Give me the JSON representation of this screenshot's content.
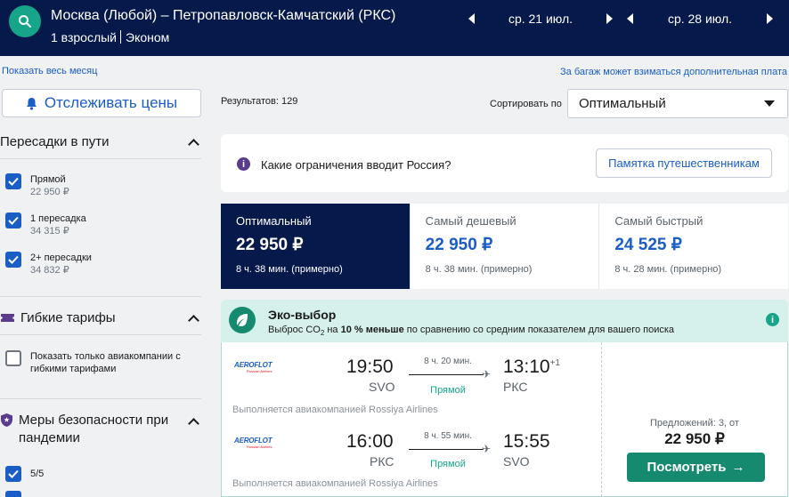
{
  "header": {
    "route": "Москва (Любой) – Петропавловск-Камчатский (РКС)",
    "passengers": "1 взрослый",
    "cabin": "Эконом",
    "date_out": "ср. 21 июл.",
    "date_back": "ср. 28 июл.",
    "colors": {
      "background": "#06194b",
      "search_button": "#17a589"
    },
    "icons": [
      "search-icon",
      "prev-date-icon",
      "next-date-icon"
    ]
  },
  "links": {
    "show_month": "Показать весь месяц",
    "baggage_note": "За багаж может взиматься дополнительная плата"
  },
  "sidebar": {
    "track_prices": "Отслеживать цены",
    "stops_section": {
      "title": "Пересадки в пути",
      "options": [
        {
          "label": "Прямой",
          "price": "22 950 ₽",
          "checked": true
        },
        {
          "label": "1 пересадка",
          "price": "34 315 ₽",
          "checked": true
        },
        {
          "label": "2+ пересадки",
          "price": "34 832 ₽",
          "checked": true
        }
      ]
    },
    "flex_section": {
      "title": "Гибкие тарифы",
      "option": "Показать только авиакомпании с гибкими тарифами",
      "checked": false
    },
    "safety_section": {
      "title": "Меры безопасности при пандемии",
      "option": "5/5",
      "checked": true
    }
  },
  "main": {
    "results": "Результатов: 129",
    "sort_label": "Сортировать по",
    "sort_value": "Оптимальный",
    "info": {
      "question": "Какие ограничения вводит Россия?",
      "memo_button": "Памятка путешественникам"
    },
    "sort_tabs": [
      {
        "name": "Оптимальный",
        "price": "22 950 ₽",
        "duration": "8 ч. 38 мин. (примерно)",
        "active": true
      },
      {
        "name": "Самый дешевый",
        "price": "22 950 ₽",
        "duration": "8 ч. 38 мин. (примерно)",
        "active": false
      },
      {
        "name": "Самый быстрый",
        "price": "24 525 ₽",
        "duration": "8 ч. 28 мин. (примерно)",
        "active": false
      }
    ],
    "eco": {
      "title": "Эко-выбор",
      "desc_pre": "Выброс CO",
      "desc_sub": "2",
      "desc_mid": " на ",
      "desc_bold": "10 % меньше",
      "desc_post": " по сравнению со средним показателем для вашего поиска"
    },
    "result": {
      "airline": "AEROFLOT",
      "airline_sub": "Russian Airlines",
      "legs": [
        {
          "dep_time": "19:50",
          "dep_code": "SVO",
          "arr_time": "13:10",
          "plus_day": "+1",
          "arr_code": "РКС",
          "duration": "8 ч. 20 мин.",
          "stops": "Прямой",
          "operated": "Выполняется авиакомпанией Rossiya Airlines"
        },
        {
          "dep_time": "16:00",
          "dep_code": "РКС",
          "arr_time": "15:55",
          "plus_day": "",
          "arr_code": "SVO",
          "duration": "8 ч. 55 мин.",
          "stops": "Прямой",
          "operated": "Выполняется авиакомпанией Rossiya Airlines"
        }
      ],
      "offers": "Предложений: 3, от",
      "price": "22 950 ₽",
      "view_button": "Посмотреть"
    }
  }
}
